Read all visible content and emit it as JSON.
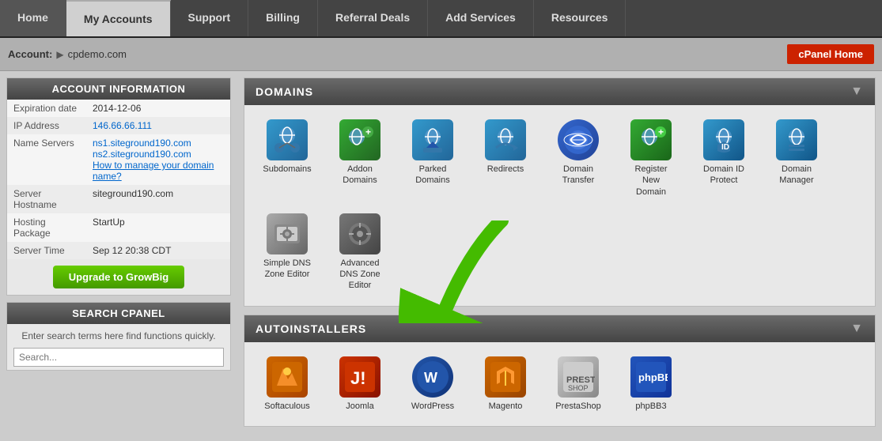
{
  "nav": {
    "items": [
      {
        "label": "Home",
        "active": false
      },
      {
        "label": "My Accounts",
        "active": true
      },
      {
        "label": "Support",
        "active": false
      },
      {
        "label": "Billing",
        "active": false
      },
      {
        "label": "Referral Deals",
        "active": false
      },
      {
        "label": "Add Services",
        "active": false
      },
      {
        "label": "Resources",
        "active": false
      }
    ]
  },
  "account_bar": {
    "label": "Account:",
    "arrow": "▶",
    "domain": "cpdemo.com",
    "cpanel_btn": "cPanel Home"
  },
  "account_info": {
    "title": "ACCOUNT INFORMATION",
    "fields": [
      {
        "label": "Expiration date",
        "value": "2014-12-06",
        "link": false
      },
      {
        "label": "IP Address",
        "value": "146.66.66.111",
        "link": true
      },
      {
        "label": "Name Servers",
        "value": "",
        "link": false
      }
    ],
    "nameservers": [
      "ns1.siteground190.com",
      "ns2.siteground190.com"
    ],
    "manage_link": "How to manage your domain name?",
    "rows": [
      {
        "label": "Server Hostname",
        "value": "siteground190.com",
        "link": false
      },
      {
        "label": "Hosting Package",
        "value": "StartUp",
        "link": false
      },
      {
        "label": "Server Time",
        "value": "Sep 12 20:38 CDT",
        "link": false
      }
    ],
    "upgrade_btn": "Upgrade to GrowBig"
  },
  "search_cpanel": {
    "title": "SEARCH CPANEL",
    "desc": "Enter search terms here find functions quickly.",
    "placeholder": "Search..."
  },
  "domains_section": {
    "title": "DOMAINS",
    "chevron": "▼",
    "icons": [
      {
        "label": "Subdomains",
        "icon_class": "icon-subdomains",
        "symbol": "🌐"
      },
      {
        "label": "Addon\nDomains",
        "icon_class": "icon-addon",
        "symbol": "🌐"
      },
      {
        "label": "Parked\nDomains",
        "icon_class": "icon-parked",
        "symbol": "🌐"
      },
      {
        "label": "Redirects",
        "icon_class": "icon-redirects",
        "symbol": "🌐"
      },
      {
        "label": "Domain\nTransfer",
        "icon_class": "icon-transfer",
        "symbol": "🌐"
      },
      {
        "label": "Register\nNew\nDomain",
        "icon_class": "icon-register",
        "symbol": "🌐"
      },
      {
        "label": "Domain ID\nProtect",
        "icon_class": "icon-protect",
        "symbol": "🌐"
      },
      {
        "label": "Domain\nManager",
        "icon_class": "icon-manager",
        "symbol": "🌐"
      },
      {
        "label": "Simple DNS\nZone Editor",
        "icon_class": "icon-simpledns",
        "symbol": "⚙"
      },
      {
        "label": "Advanced\nDNS Zone\nEditor",
        "icon_class": "icon-advanced",
        "symbol": "⚙"
      }
    ]
  },
  "autoinstallers_section": {
    "title": "AUTOINSTALLERS",
    "chevron": "▼",
    "icons": [
      {
        "label": "Softaculous",
        "icon_class": "icon-softaculous",
        "symbol": "🔥"
      },
      {
        "label": "Joomla",
        "icon_class": "icon-joomla",
        "symbol": "J"
      },
      {
        "label": "WordPress",
        "icon_class": "icon-wordpress",
        "symbol": "W"
      },
      {
        "label": "Magento",
        "icon_class": "icon-magento",
        "symbol": "M"
      },
      {
        "label": "PrestaShop",
        "icon_class": "icon-prestashop",
        "symbol": "P"
      },
      {
        "label": "phpBB3",
        "icon_class": "icon-phpbb3",
        "symbol": "bb"
      }
    ]
  }
}
